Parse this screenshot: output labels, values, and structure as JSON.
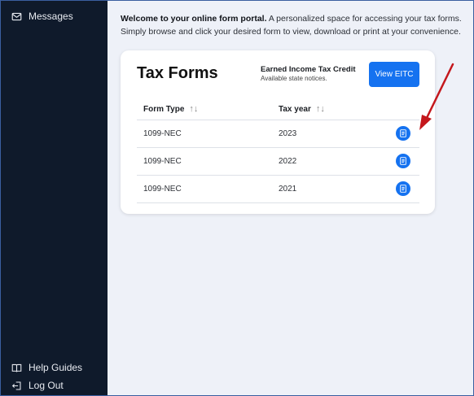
{
  "sidebar": {
    "top_item": {
      "label": "Messages",
      "icon": "envelope-icon"
    },
    "bottom_items": [
      {
        "label": "Help Guides",
        "icon": "book-icon"
      },
      {
        "label": "Log Out",
        "icon": "logout-icon"
      }
    ]
  },
  "welcome": {
    "bold": "Welcome to your online form portal.",
    "text": " A personalized space for accessing your tax forms. Simply browse and click your desired form to view, download or print at your convenience."
  },
  "card": {
    "title": "Tax Forms",
    "eitc_title": "Earned Income Tax Credit",
    "eitc_subtitle": "Available state notices.",
    "eitc_button": "View EITC"
  },
  "table": {
    "headers": {
      "form_type": "Form Type",
      "tax_year": "Tax year",
      "sort_glyph": "↑↓"
    },
    "rows": [
      {
        "form_type": "1099-NEC",
        "tax_year": "2023"
      },
      {
        "form_type": "1099-NEC",
        "tax_year": "2022"
      },
      {
        "form_type": "1099-NEC",
        "tax_year": "2021"
      }
    ]
  },
  "colors": {
    "sidebar_bg": "#0f1a2b",
    "accent": "#1572f0",
    "main_bg": "#eef1f8",
    "annotation_arrow": "#c4171c"
  }
}
